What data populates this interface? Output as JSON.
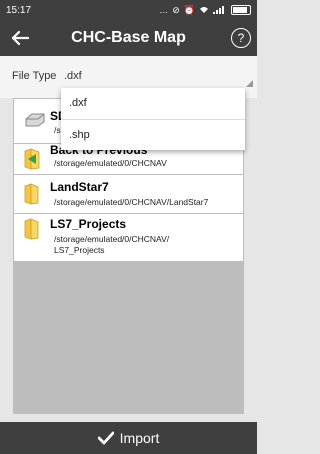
{
  "status_bar": {
    "time": "15:17",
    "icons": [
      "dots-icon",
      "no-sim-icon",
      "alarm-icon",
      "wifi-icon",
      "signal-icon",
      "battery-icon"
    ]
  },
  "app_bar": {
    "title": "CHC-Base Map"
  },
  "file_type": {
    "label": "File Type",
    "value": ".dxf"
  },
  "dropdown": {
    "options": [
      ".dxf",
      ".shp"
    ]
  },
  "items": [
    {
      "name": "SD",
      "path": "/s",
      "icon": "sd-card-icon"
    },
    {
      "name": "Back to Previous",
      "path": "/storage/emulated/0/CHCNAV",
      "icon": "back-folder-icon"
    },
    {
      "name": "LandStar7",
      "path": "/storage/emulated/0/CHCNAV/LandStar7",
      "icon": "folder-icon"
    },
    {
      "name": "LS7_Projects",
      "path_line1": "/storage/emulated/0/CHCNAV/",
      "path_line2": "LS7_Projects",
      "icon": "folder-icon"
    }
  ],
  "bottom": {
    "import_label": "Import"
  },
  "colors": {
    "bar": "#3f3f3f",
    "background": "#e6e6e6",
    "list_bg": "#bdbdbd",
    "folder": "#f5c542"
  }
}
